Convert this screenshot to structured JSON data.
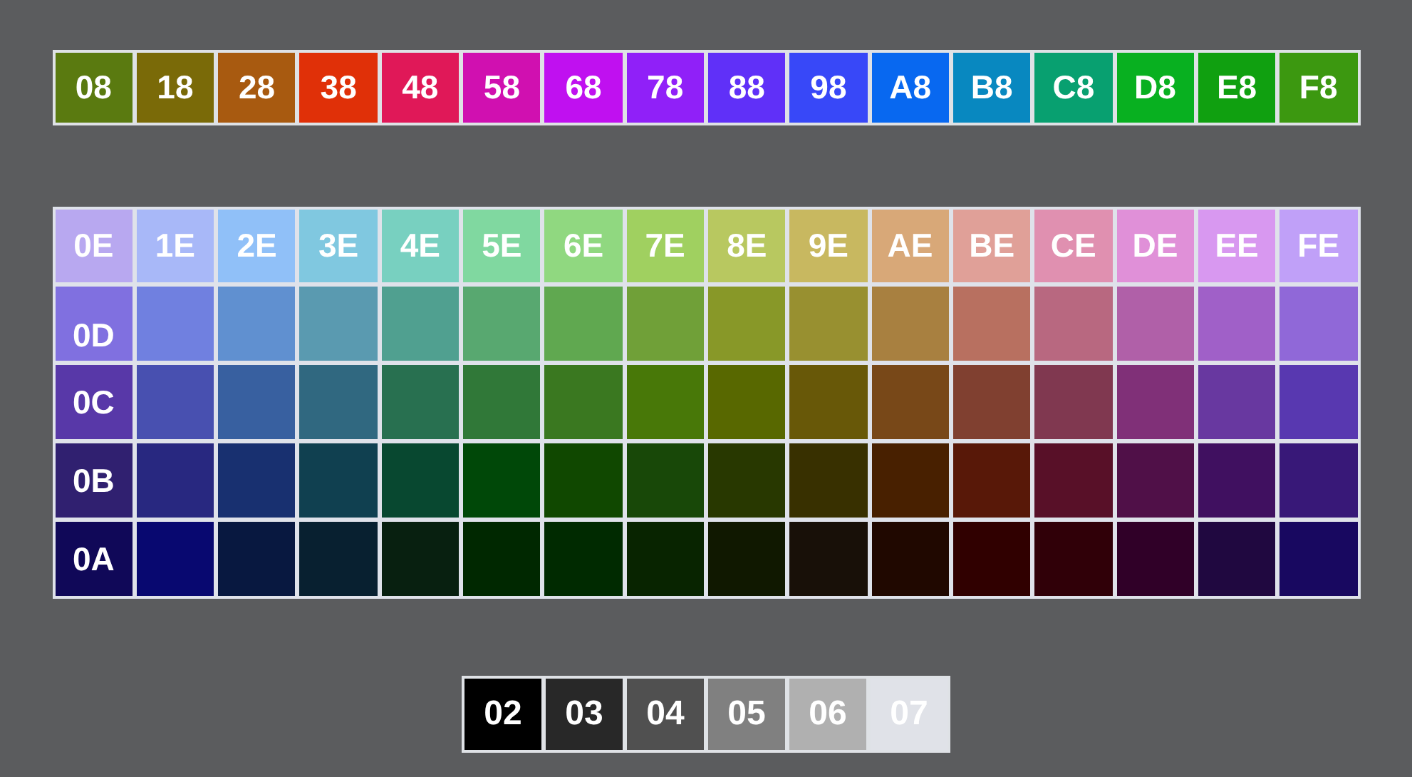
{
  "top_row": [
    {
      "label": "08",
      "color": "#5a7a10"
    },
    {
      "label": "18",
      "color": "#7a6a08"
    },
    {
      "label": "28",
      "color": "#a85a10"
    },
    {
      "label": "38",
      "color": "#e03008"
    },
    {
      "label": "48",
      "color": "#e01858"
    },
    {
      "label": "58",
      "color": "#d010b0"
    },
    {
      "label": "68",
      "color": "#c010f0"
    },
    {
      "label": "78",
      "color": "#9020f8"
    },
    {
      "label": "88",
      "color": "#6030f8"
    },
    {
      "label": "98",
      "color": "#3848f8"
    },
    {
      "label": "A8",
      "color": "#0868f0"
    },
    {
      "label": "B8",
      "color": "#0888c0"
    },
    {
      "label": "C8",
      "color": "#08a070"
    },
    {
      "label": "D8",
      "color": "#08b020"
    },
    {
      "label": "E8",
      "color": "#10a010"
    },
    {
      "label": "F8",
      "color": "#3c9810"
    }
  ],
  "grid_rows": [
    {
      "cells": [
        {
          "label": "0E",
          "color": "#b8a8f0"
        },
        {
          "label": "1E",
          "color": "#a8b8f8"
        },
        {
          "label": "2E",
          "color": "#90c0f8"
        },
        {
          "label": "3E",
          "color": "#80c8e0"
        },
        {
          "label": "4E",
          "color": "#78d0c0"
        },
        {
          "label": "5E",
          "color": "#80d8a0"
        },
        {
          "label": "6E",
          "color": "#90d880"
        },
        {
          "label": "7E",
          "color": "#a0d060"
        },
        {
          "label": "8E",
          "color": "#b8c860"
        },
        {
          "label": "9E",
          "color": "#c8b860"
        },
        {
          "label": "AE",
          "color": "#d8a878"
        },
        {
          "label": "BE",
          "color": "#e0a098"
        },
        {
          "label": "CE",
          "color": "#e090b0"
        },
        {
          "label": "DE",
          "color": "#e090d8"
        },
        {
          "label": "EE",
          "color": "#d898f0"
        },
        {
          "label": "FE",
          "color": "#c0a0f8"
        }
      ]
    },
    {
      "cells": [
        {
          "label": "0D",
          "color": "#8070e0"
        },
        {
          "color": "#7080e0"
        },
        {
          "color": "#6090d0"
        },
        {
          "color": "#5a9ab0"
        },
        {
          "color": "#50a090"
        },
        {
          "color": "#58a870"
        },
        {
          "color": "#60a850"
        },
        {
          "color": "#70a038"
        },
        {
          "color": "#889828"
        },
        {
          "color": "#989030"
        },
        {
          "color": "#a88040"
        },
        {
          "color": "#b87060"
        },
        {
          "color": "#b86880"
        },
        {
          "color": "#b060a8"
        },
        {
          "color": "#a060c8"
        },
        {
          "color": "#9068d8"
        }
      ]
    },
    {
      "cells": [
        {
          "label": "0C",
          "color": "#5838a8"
        },
        {
          "color": "#4850b0"
        },
        {
          "color": "#3860a0"
        },
        {
          "color": "#306880"
        },
        {
          "color": "#287050"
        },
        {
          "color": "#307838"
        },
        {
          "color": "#3a7820"
        },
        {
          "color": "#487808"
        },
        {
          "color": "#586800"
        },
        {
          "color": "#685808"
        },
        {
          "color": "#784818"
        },
        {
          "color": "#804030"
        },
        {
          "color": "#803850"
        },
        {
          "color": "#803078"
        },
        {
          "color": "#6838a0"
        },
        {
          "color": "#5838b0"
        }
      ]
    },
    {
      "cells": [
        {
          "label": "0B",
          "color": "#302070"
        },
        {
          "color": "#282880"
        },
        {
          "color": "#183070"
        },
        {
          "color": "#104050"
        },
        {
          "color": "#084830"
        },
        {
          "color": "#004808"
        },
        {
          "color": "#104800"
        },
        {
          "color": "#184808"
        },
        {
          "color": "#283800"
        },
        {
          "color": "#383000"
        },
        {
          "color": "#482000"
        },
        {
          "color": "#581808"
        },
        {
          "color": "#581028"
        },
        {
          "color": "#501048"
        },
        {
          "color": "#401060"
        },
        {
          "color": "#381878"
        }
      ]
    },
    {
      "cells": [
        {
          "label": "0A",
          "color": "#100858"
        },
        {
          "color": "#080870"
        },
        {
          "color": "#081840"
        },
        {
          "color": "#082030"
        },
        {
          "color": "#082010"
        },
        {
          "color": "#002800"
        },
        {
          "color": "#002a00"
        },
        {
          "color": "#082400"
        },
        {
          "color": "#101800"
        },
        {
          "color": "#181008"
        },
        {
          "color": "#200800"
        },
        {
          "color": "#300000"
        },
        {
          "color": "#300008"
        },
        {
          "color": "#300028"
        },
        {
          "color": "#200840"
        },
        {
          "color": "#180860"
        }
      ]
    }
  ],
  "gray_row": [
    {
      "label": "02",
      "color": "#000000"
    },
    {
      "label": "03",
      "color": "#282828"
    },
    {
      "label": "04",
      "color": "#505050"
    },
    {
      "label": "05",
      "color": "#808080"
    },
    {
      "label": "06",
      "color": "#b0b0b0"
    },
    {
      "label": "07",
      "color": "#e0e2e8"
    }
  ]
}
